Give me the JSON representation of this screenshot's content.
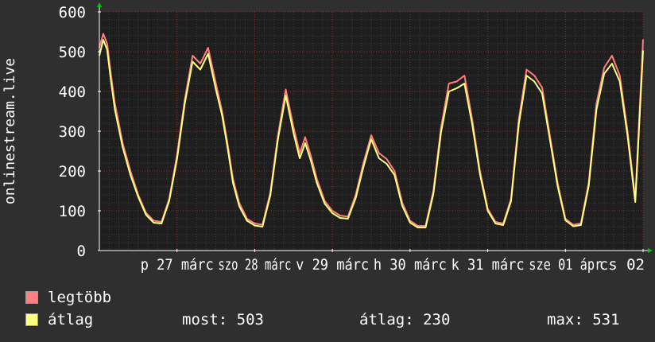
{
  "colors": {
    "background": "#2f2f2f",
    "plot_background": "#1e1e1e",
    "grid_minor": "#3a3a3a",
    "grid_major": "#8a2a2a",
    "axis": "#ffffff",
    "arrow": "#00cc00"
  },
  "chart_data": {
    "type": "line",
    "ylabel": "onlinestream.live",
    "ylim": [
      0,
      600
    ],
    "y_ticks": [
      "0",
      "100",
      "200",
      "300",
      "400",
      "500",
      "600"
    ],
    "x_range_days": [
      26,
      33
    ],
    "x_tick_labels": [
      {
        "day": 27,
        "label": "p 27 márc"
      },
      {
        "day": 28,
        "label": "szo 28 márc"
      },
      {
        "day": 29,
        "label": "v 29 márc"
      },
      {
        "day": 30,
        "label": "h 30 márc"
      },
      {
        "day": 31,
        "label": "k 31 márc"
      },
      {
        "day": 32,
        "label": "sze 01 ápr"
      },
      {
        "day": 33,
        "label": "cs 02"
      }
    ],
    "series": [
      {
        "name": "legtöbb",
        "color": "#ff7f7f",
        "x": [
          26.0,
          26.05,
          26.1,
          26.15,
          26.2,
          26.3,
          26.4,
          26.5,
          26.6,
          26.7,
          26.8,
          26.9,
          27.0,
          27.1,
          27.2,
          27.3,
          27.4,
          27.5,
          27.58,
          27.65,
          27.72,
          27.8,
          27.9,
          28.0,
          28.1,
          28.2,
          28.3,
          28.4,
          28.5,
          28.58,
          28.65,
          28.72,
          28.8,
          28.9,
          29.0,
          29.1,
          29.2,
          29.3,
          29.4,
          29.5,
          29.6,
          29.7,
          29.8,
          29.9,
          30.0,
          30.1,
          30.2,
          30.3,
          30.4,
          30.5,
          30.6,
          30.7,
          30.8,
          30.9,
          31.0,
          31.1,
          31.2,
          31.3,
          31.4,
          31.5,
          31.6,
          31.7,
          31.8,
          31.9,
          32.0,
          32.1,
          32.2,
          32.3,
          32.4,
          32.5,
          32.6,
          32.7,
          32.8,
          32.9,
          33.0
        ],
        "values": [
          510,
          545,
          520,
          440,
          370,
          270,
          200,
          140,
          95,
          75,
          72,
          130,
          240,
          380,
          490,
          470,
          510,
          420,
          350,
          270,
          180,
          120,
          80,
          68,
          65,
          145,
          290,
          405,
          310,
          245,
          285,
          240,
          180,
          125,
          100,
          88,
          85,
          140,
          220,
          290,
          245,
          230,
          200,
          120,
          75,
          62,
          62,
          150,
          310,
          420,
          425,
          440,
          330,
          200,
          105,
          72,
          68,
          130,
          330,
          455,
          440,
          410,
          290,
          170,
          80,
          65,
          68,
          170,
          370,
          460,
          490,
          440,
          300,
          130,
          531
        ]
      },
      {
        "name": "átlag",
        "color": "#ffff80",
        "x": [
          26.0,
          26.05,
          26.1,
          26.15,
          26.2,
          26.3,
          26.4,
          26.5,
          26.6,
          26.7,
          26.8,
          26.9,
          27.0,
          27.1,
          27.2,
          27.3,
          27.4,
          27.5,
          27.58,
          27.65,
          27.72,
          27.8,
          27.9,
          28.0,
          28.1,
          28.2,
          28.3,
          28.4,
          28.5,
          28.58,
          28.65,
          28.72,
          28.8,
          28.9,
          29.0,
          29.1,
          29.2,
          29.3,
          29.4,
          29.5,
          29.6,
          29.7,
          29.8,
          29.9,
          30.0,
          30.1,
          30.2,
          30.3,
          30.4,
          30.5,
          30.6,
          30.7,
          30.8,
          30.9,
          31.0,
          31.1,
          31.2,
          31.3,
          31.4,
          31.5,
          31.6,
          31.7,
          31.8,
          31.9,
          32.0,
          32.1,
          32.2,
          32.3,
          32.4,
          32.5,
          32.6,
          32.7,
          32.8,
          32.9,
          33.0
        ],
        "values": [
          490,
          530,
          505,
          425,
          355,
          260,
          190,
          135,
          90,
          70,
          68,
          125,
          230,
          370,
          475,
          455,
          495,
          405,
          340,
          260,
          170,
          112,
          75,
          63,
          60,
          138,
          280,
          390,
          295,
          232,
          270,
          228,
          170,
          118,
          94,
          82,
          80,
          132,
          210,
          280,
          232,
          218,
          190,
          112,
          70,
          58,
          58,
          142,
          298,
          400,
          408,
          420,
          318,
          192,
          100,
          68,
          64,
          124,
          318,
          440,
          425,
          395,
          280,
          162,
          76,
          61,
          64,
          162,
          355,
          445,
          470,
          425,
          288,
          122,
          503
        ]
      }
    ],
    "legend": [
      {
        "label": "legtöbb",
        "color": "#ff7f7f"
      },
      {
        "label": "átlag",
        "color": "#ffff80"
      }
    ],
    "stats": {
      "now": "most: 503",
      "avg": "átlag: 230",
      "max": "max: 531"
    }
  }
}
